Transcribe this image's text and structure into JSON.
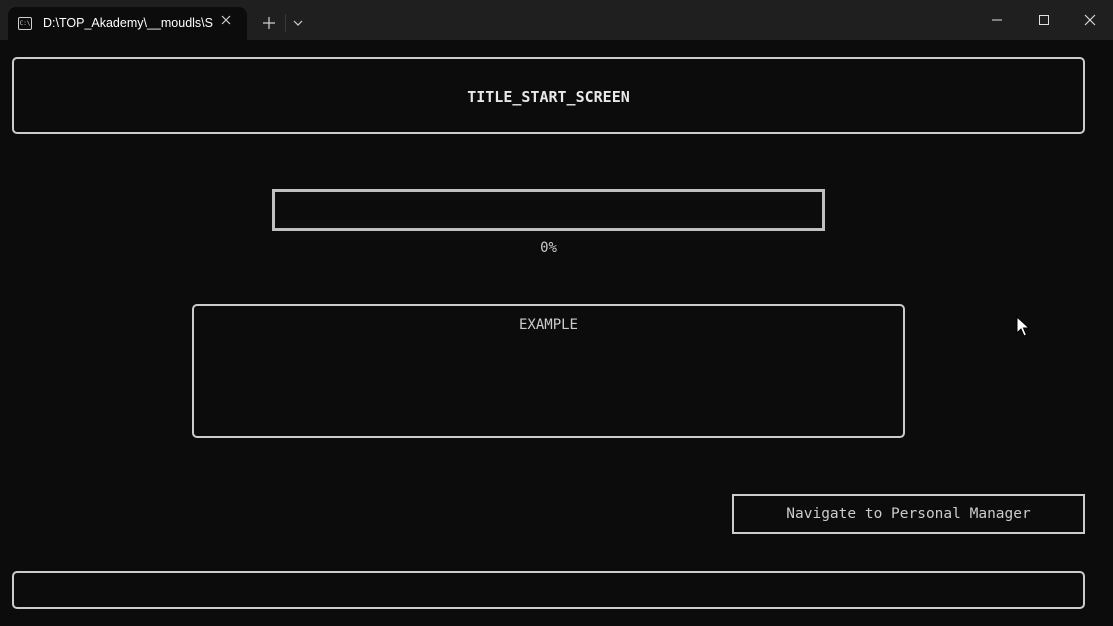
{
  "window": {
    "tab_title": "D:\\TOP_Akademy\\__moudls\\S",
    "tab_icon": "terminal-icon",
    "icon_glyph": "C:\\"
  },
  "app": {
    "title": "TITLE_START_SCREEN",
    "progress": {
      "value": 0,
      "label": "0%"
    },
    "example": {
      "title": "EXAMPLE"
    },
    "nav_button": {
      "label": "Navigate to Personal Manager"
    },
    "input": {
      "value": ""
    }
  },
  "colors": {
    "background": "#0c0c0c",
    "titlebar": "#1f1f1f",
    "foreground": "#cccccc"
  }
}
